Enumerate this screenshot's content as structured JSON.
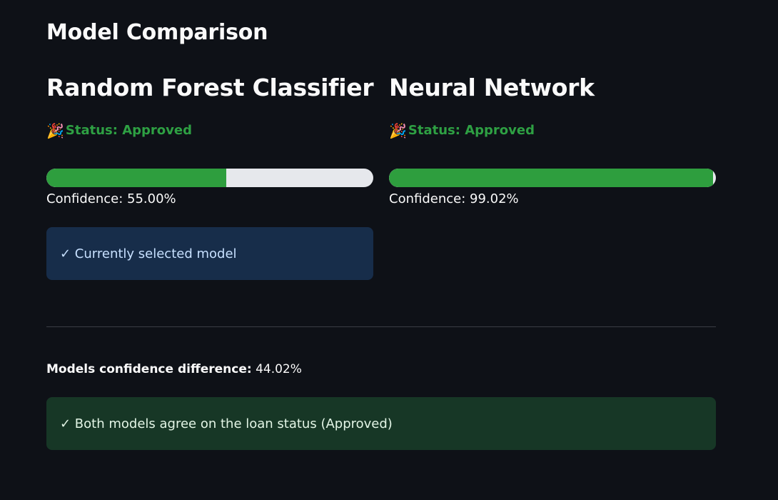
{
  "page": {
    "title": "Model Comparison"
  },
  "models": [
    {
      "name": "Random Forest Classifier",
      "status_icon": "🎉",
      "status_text": "Status: Approved",
      "confidence_fraction": 0.55,
      "confidence_text": "Confidence: 55.00%",
      "selected_text": "✓ Currently selected model"
    },
    {
      "name": "Neural Network",
      "status_icon": "🎉",
      "status_text": "Status: Approved",
      "confidence_fraction": 0.9902,
      "confidence_text": "Confidence: 99.02%"
    }
  ],
  "comparison": {
    "difference_label": "Models confidence difference:",
    "difference_value": " 44.02%",
    "agreement_text": "✓ Both models agree on the loan status (Approved)"
  },
  "colors": {
    "background": "#0e1117",
    "approved": "#2ea043",
    "bar_fill": "#2e9e3e",
    "bar_track": "#e6e8ec",
    "info_bg": "#172d4a",
    "success_bg": "#173726"
  }
}
